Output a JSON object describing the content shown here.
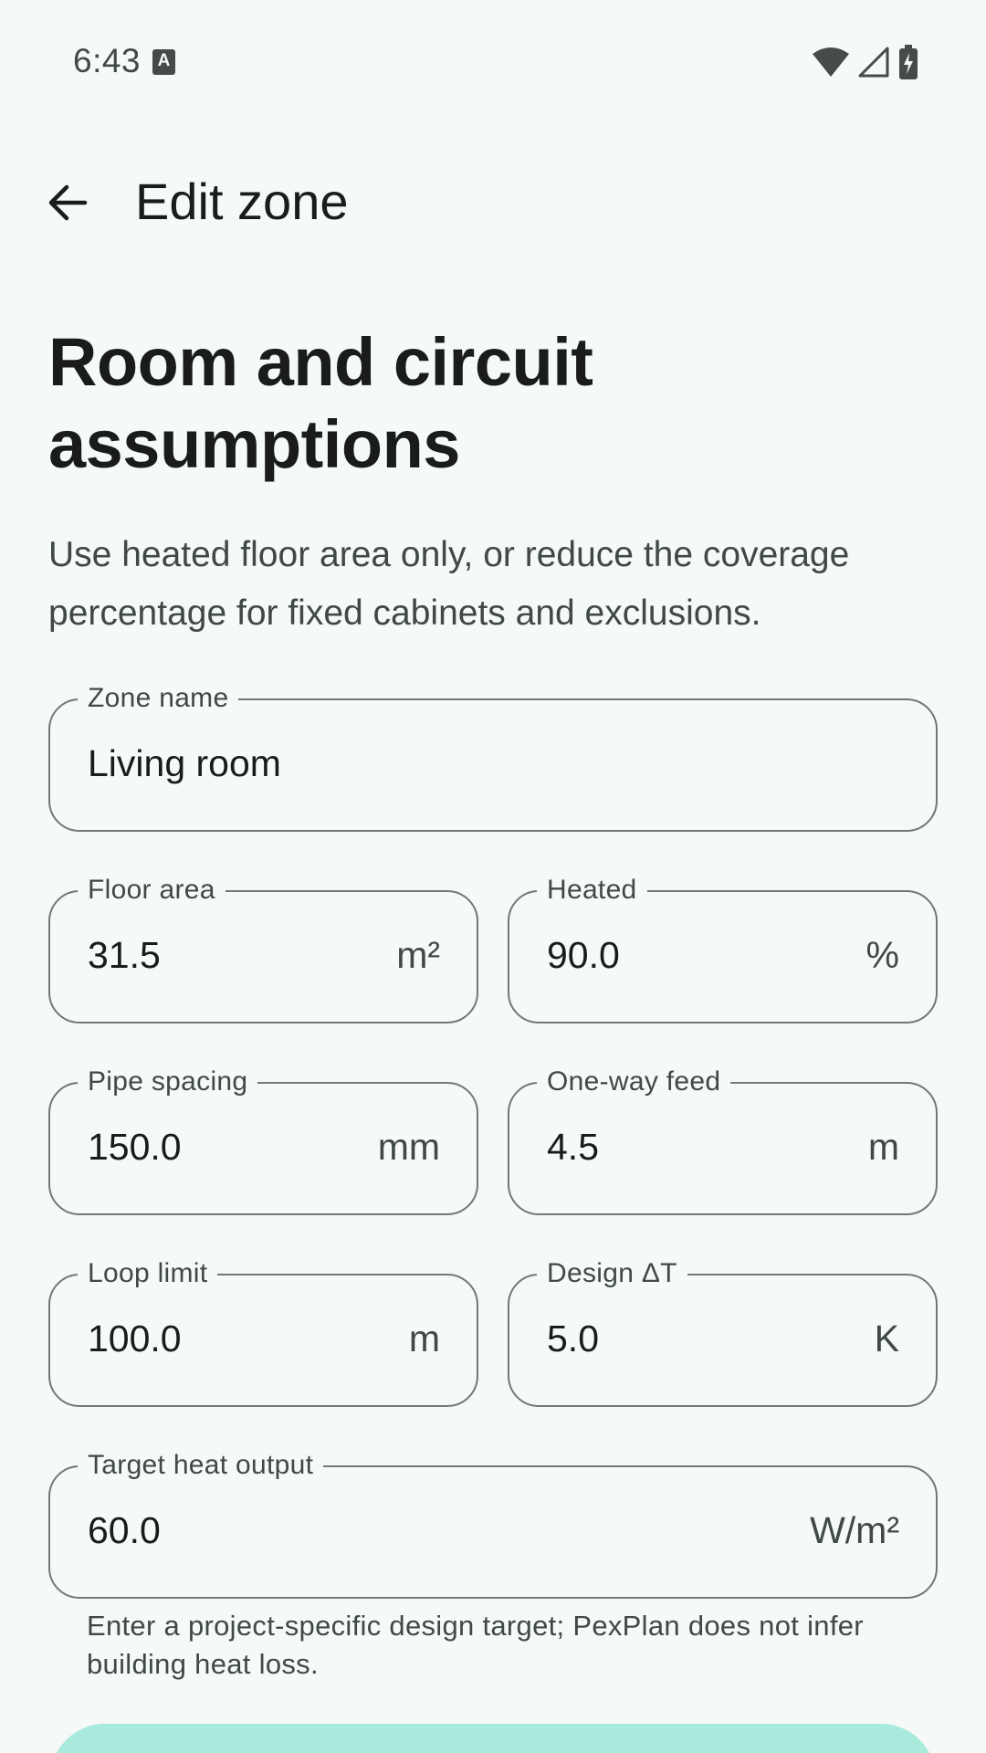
{
  "status_bar": {
    "time": "6:43",
    "keyboard_indicator": "A",
    "icons": [
      "wifi-icon",
      "signal-icon",
      "battery-charging-icon"
    ]
  },
  "app_bar": {
    "back_icon": "arrow-back-icon",
    "title": "Edit zone"
  },
  "section": {
    "heading": "Room and circuit assumptions",
    "description": "Use heated floor area only, or reduce the coverage percentage for fixed cabinets and exclusions."
  },
  "fields": {
    "zone_name": {
      "label": "Zone name",
      "value": "Living room"
    },
    "floor_area": {
      "label": "Floor area",
      "value": "31.5",
      "suffix": "m²"
    },
    "heated": {
      "label": "Heated",
      "value": "90.0",
      "suffix": "%"
    },
    "pipe_spacing": {
      "label": "Pipe spacing",
      "value": "150.0",
      "suffix": "mm"
    },
    "one_way_feed": {
      "label": "One-way feed",
      "value": "4.5",
      "suffix": "m"
    },
    "loop_limit": {
      "label": "Loop limit",
      "value": "100.0",
      "suffix": "m"
    },
    "design_dt": {
      "label": "Design ΔT",
      "value": "5.0",
      "suffix": "K"
    },
    "target_heat_output": {
      "label": "Target heat output",
      "value": "60.0",
      "suffix": "W/m²",
      "supporting_text": "Enter a project-specific design target; PexPlan does not infer building heat loss."
    }
  },
  "colors": {
    "background": "#f5f9f7",
    "outline": "#6f7975",
    "primary_container": "#a8eadb",
    "on_surface": "#191c1b",
    "on_surface_variant": "#3f4945"
  }
}
